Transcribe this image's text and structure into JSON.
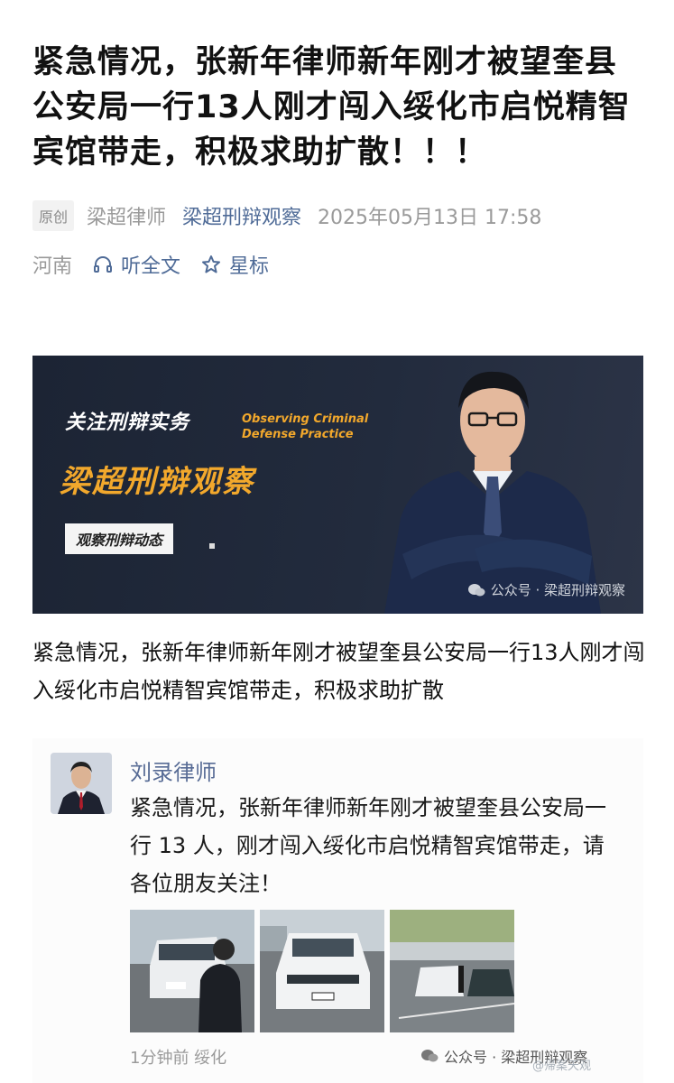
{
  "article": {
    "title": "紧急情况，张新年律师新年刚才被望奎县公安局一行13人刚才闯入绥化市启悦精智宾馆带走，积极求助扩散！！！",
    "original_badge": "原创",
    "author": "梁超律师",
    "account": "梁超刑辩观察",
    "datetime": "2025年05月13日 17:58",
    "location": "河南",
    "listen_label": "听全文",
    "star_label": "星标"
  },
  "banner": {
    "follow_text": "关注刑辩实务",
    "english_line1": "Observing Criminal",
    "english_line2": "Defense Practice",
    "main_text": "梁超刑辩观察",
    "tag_text": "观察刑辩动态",
    "watermark": "公众号 · 梁超刑辩观察"
  },
  "caption": "紧急情况，张新年律师新年刚才被望奎县公安局一行13人刚才闯入绥化市启悦精智宾馆带走，积极求助扩散",
  "screenshot": {
    "poster_name": "刘录律师",
    "post_text": "紧急情况，张新年律师新年刚才被望奎县公安局一行 13 人，刚才闯入绥化市启悦精智宾馆带走，请各位朋友关注！",
    "post_time": "1分钟前  绥化",
    "watermark": "公众号 · 梁超刑辩观察"
  },
  "weibo_watermark": "@帰案天观",
  "colors": {
    "link": "#4f6b97",
    "accent_orange": "#f2a82c",
    "banner_bg": "#1f2738"
  }
}
